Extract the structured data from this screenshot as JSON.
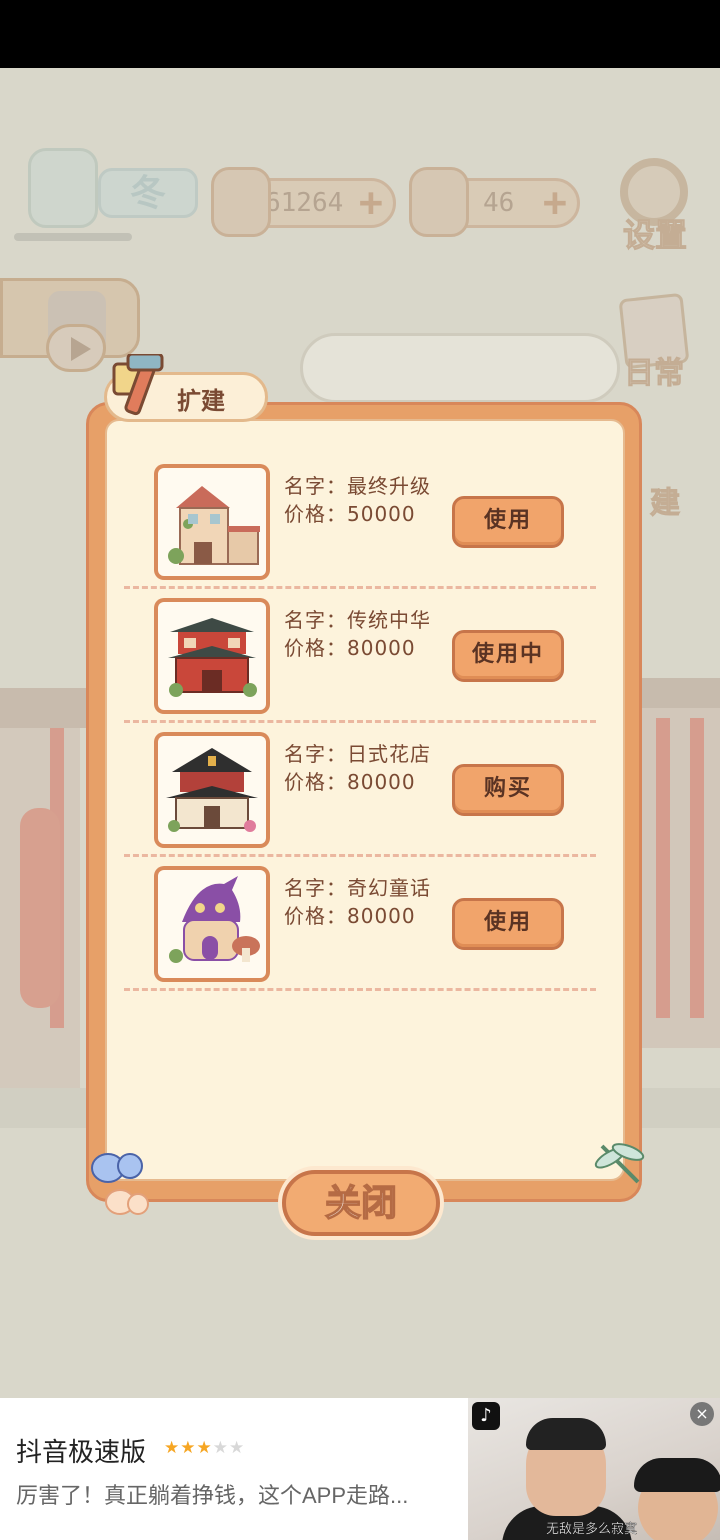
{
  "hud": {
    "season": "冬",
    "fish_currency": "61264",
    "cheese_currency": "46",
    "settings_label": "设置",
    "daily_label": "日常",
    "build_label": "建"
  },
  "modal": {
    "tab_title": "扩建",
    "items": [
      {
        "name": "名字：最终升级",
        "price": "价格：50000",
        "action": "使用"
      },
      {
        "name": "名字：传统中华",
        "price": "价格：80000",
        "action": "使用中"
      },
      {
        "name": "名字：日式花店",
        "price": "价格：80000",
        "action": "购买"
      },
      {
        "name": "名字：奇幻童话",
        "price": "价格：80000",
        "action": "使用"
      }
    ],
    "close_label": "关闭"
  },
  "ad": {
    "title": "抖音极速版",
    "rating": 3,
    "description": "厉害了！真正躺着挣钱，这个APP走路...",
    "video_caption": "无敌是多么寂寞",
    "close_symbol": "×"
  },
  "colors": {
    "panel_orange": "#e7a068",
    "panel_cream": "#fdf3dc",
    "button_orange": "#f1a46b",
    "text_brown": "#7a4a33"
  }
}
